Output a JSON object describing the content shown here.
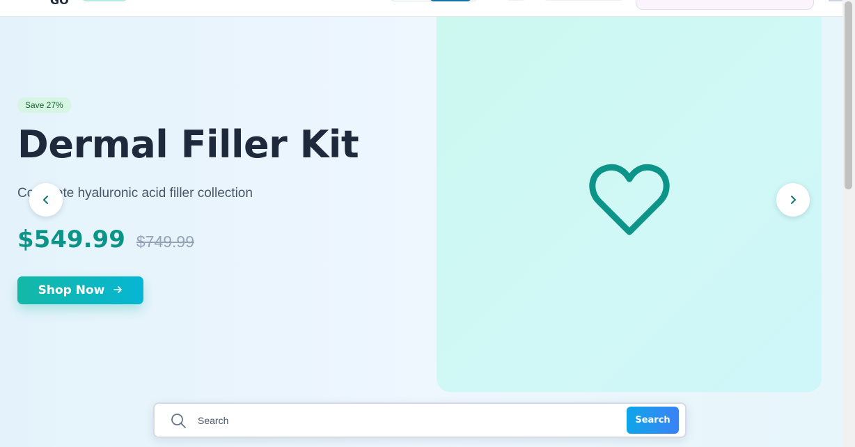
{
  "colors": {
    "brand_teal": "#14b8a6",
    "price": "#0d9488",
    "badge_bg": "#d7f5e3",
    "badge_text": "#166534",
    "search_button": "#0ea5e9",
    "title": "#1e293b"
  },
  "hero": {
    "badge": "Save 27%",
    "title": "Dermal Filler Kit",
    "subtitle": "Complete hyaluronic acid filler collection",
    "price": "$549.99",
    "original_price": "$749.99",
    "cta_label": "Shop Now",
    "cta_icon": "arrow-right-icon",
    "visual_icon": "heart-icon"
  },
  "carousel": {
    "prev_icon": "chevron-left-icon",
    "next_icon": "chevron-right-icon"
  },
  "search": {
    "placeholder": "Search",
    "value": "",
    "button_label": "Search",
    "icon": "search-icon"
  }
}
